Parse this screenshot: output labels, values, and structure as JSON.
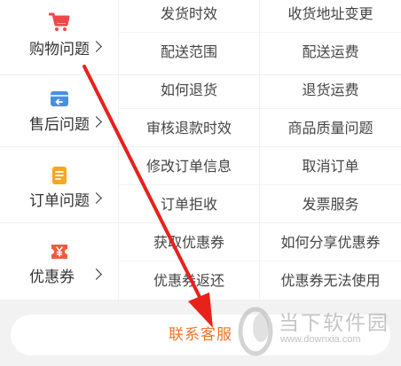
{
  "categories": [
    {
      "label": "购物问题",
      "icon": "shopping-cart-icon",
      "icon_color": "#f04848",
      "questions": [
        "发货时效",
        "收货地址变更",
        "配送范围",
        "配送运费"
      ]
    },
    {
      "label": "售后问题",
      "icon": "return-icon",
      "icon_color": "#4a90e2",
      "questions": [
        "如何退货",
        "退货运费",
        "审核退款时效",
        "商品质量问题"
      ]
    },
    {
      "label": "订单问题",
      "icon": "order-list-icon",
      "icon_color": "#f5a623",
      "questions": [
        "修改订单信息",
        "取消订单",
        "订单拒收",
        "发票服务"
      ]
    },
    {
      "label": "优惠券",
      "icon": "coupon-icon",
      "icon_color": "#f05a3a",
      "questions": [
        "获取优惠券",
        "如何分享优惠券",
        "优惠券返还",
        "优惠券无法使用"
      ]
    }
  ],
  "footer": {
    "contact_label": "联系客服",
    "accent_color": "#f0742a"
  },
  "watermark": {
    "title": "当下软件园",
    "url": "www.downxia.com"
  },
  "annotation": {
    "arrow_color": "#e8211b"
  }
}
